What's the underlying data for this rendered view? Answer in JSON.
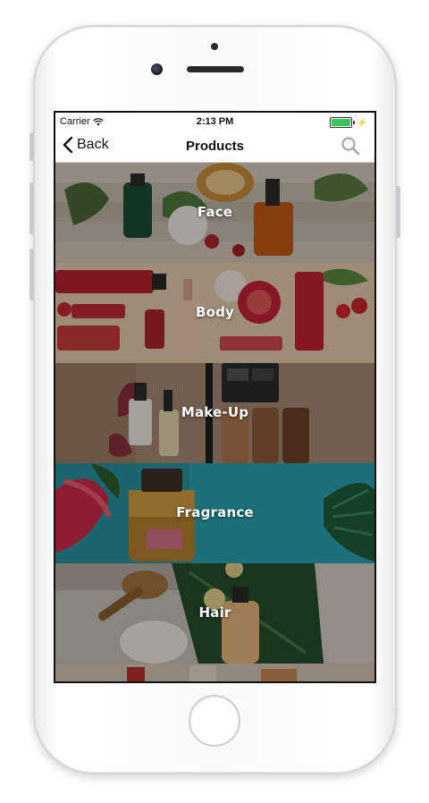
{
  "status_bar": {
    "carrier": "Carrier",
    "time": "2:13 PM",
    "battery_level": 1.0,
    "battery_color": "#35c759"
  },
  "nav": {
    "back_label": "Back",
    "title": "Products",
    "search_icon": "search-icon"
  },
  "categories": [
    {
      "label": "Face"
    },
    {
      "label": "Body"
    },
    {
      "label": "Make-Up"
    },
    {
      "label": "Fragrance"
    },
    {
      "label": "Hair"
    }
  ],
  "colors": {
    "accent_search": "#a8a8a8",
    "label_text": "#ffffff"
  }
}
